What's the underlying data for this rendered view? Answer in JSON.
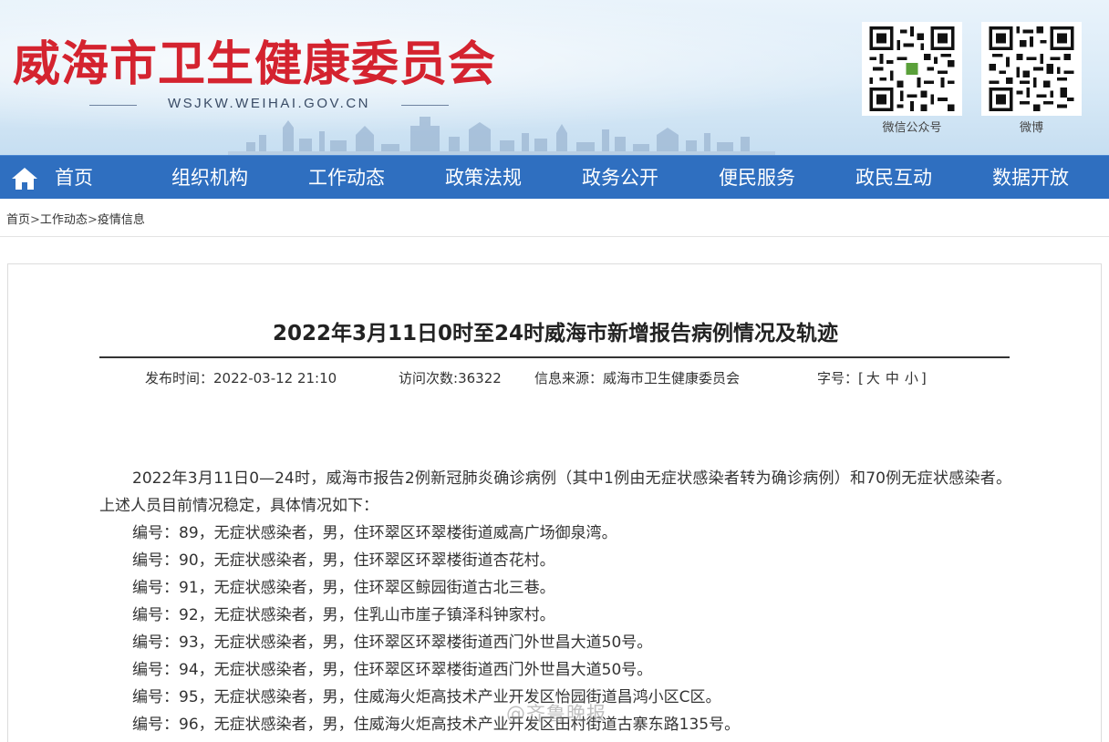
{
  "header": {
    "site_title": "威海市卫生健康委员会",
    "site_url": "WSJKW.WEIHAI.GOV.CN",
    "qr_wechat_label": "微信公众号",
    "qr_weibo_label": "微博"
  },
  "nav": {
    "home": "首页",
    "items": [
      "组织机构",
      "工作动态",
      "政策法规",
      "政务公开",
      "便民服务",
      "政民互动",
      "数据开放"
    ]
  },
  "breadcrumb": {
    "items": [
      "首页",
      "工作动态",
      "疫情信息"
    ],
    "separator": ">"
  },
  "article": {
    "title": "2022年3月11日0时至24时威海市新增报告病例情况及轨迹",
    "publish_label": "发布时间：",
    "publish_time": "2022-03-12 21:10",
    "visits_label": "访问次数:",
    "visits": "36322",
    "source_label": "信息来源：",
    "source": "威海市卫生健康委员会",
    "font_label": "字号：",
    "font_open": "[",
    "font_large": "大",
    "font_medium": "中",
    "font_small": "小",
    "font_close": "]",
    "intro": "2022年3月11日0—24时，威海市报告2例新冠肺炎确诊病例（其中1例由无症状感染者转为确诊病例）和70例无症状感染者。上述人员目前情况稳定，具体情况如下：",
    "cases": [
      "编号：89，无症状感染者，男，住环翠区环翠楼街道威高广场御泉湾。",
      "编号：90，无症状感染者，男，住环翠区环翠楼街道杏花村。",
      "编号：91，无症状感染者，男，住环翠区鲸园街道古北三巷。",
      "编号：92，无症状感染者，男，住乳山市崖子镇泽科钟家村。",
      "编号：93，无症状感染者，男，住环翠区环翠楼街道西门外世昌大道50号。",
      "编号：94，无症状感染者，男，住环翠区环翠楼街道西门外世昌大道50号。",
      "编号：95，无症状感染者，男，住威海火炬高技术产业开发区怡园街道昌鸿小区C区。",
      "编号：96，无症状感染者，男，住威海火炬高技术产业开发区田村街道古寨东路135号。"
    ]
  },
  "watermark": "@齐鲁晚报",
  "colors": {
    "title_red": "#d4232f",
    "nav_blue": "#2f6fc0"
  }
}
